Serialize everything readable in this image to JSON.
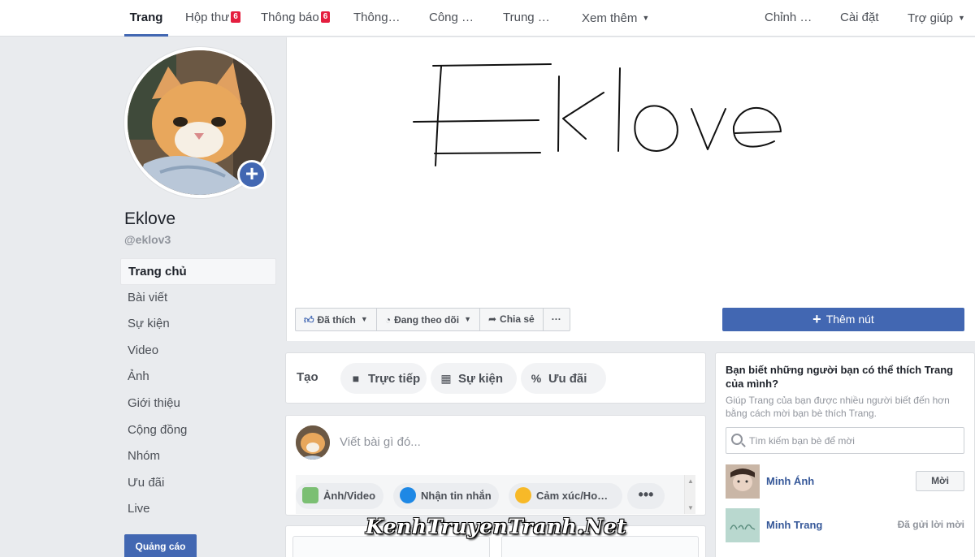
{
  "nav": {
    "tabs": [
      {
        "label": "Trang"
      },
      {
        "label": "Hộp thư",
        "badge": "6"
      },
      {
        "label": "Thông báo",
        "badge": "6"
      },
      {
        "label": "Thông…"
      },
      {
        "label": "Công …"
      },
      {
        "label": "Trung …"
      },
      {
        "label": "Xem thêm"
      }
    ],
    "right": [
      {
        "label": "Chỉnh …"
      },
      {
        "label": "Cài đặt"
      },
      {
        "label": "Trợ giúp"
      }
    ]
  },
  "page": {
    "name": "Eklove",
    "handle": "@eklov3",
    "cover_text": "Eklove"
  },
  "sidebar": {
    "items": [
      {
        "label": "Trang chủ"
      },
      {
        "label": "Bài viết"
      },
      {
        "label": "Sự kiện"
      },
      {
        "label": "Video"
      },
      {
        "label": "Ảnh"
      },
      {
        "label": "Giới thiệu"
      },
      {
        "label": "Cộng đồng"
      },
      {
        "label": "Nhóm"
      },
      {
        "label": "Ưu đãi"
      },
      {
        "label": "Live"
      }
    ],
    "ads_button": "Quảng cáo"
  },
  "actions": {
    "liked": "Đã thích",
    "following": "Đang theo dõi",
    "share": "Chia sẻ",
    "more": "···",
    "add_button": "Thêm nút"
  },
  "create": {
    "label": "Tạo",
    "live": "Trực tiếp",
    "event": "Sự kiện",
    "offer": "Ưu đãi"
  },
  "composer": {
    "placeholder": "Viết bài gì đó...",
    "photo": "Ảnh/Video",
    "messages": "Nhận tin nhắn",
    "feeling": "Cảm xúc/Ho…",
    "more": "•••"
  },
  "invite": {
    "title": "Bạn biết những người bạn có thể thích Trang của mình?",
    "desc": "Giúp Trang của bạn được nhiều người biết đến hơn bằng cách mời bạn bè thích Trang.",
    "search_placeholder": "Tìm kiếm bạn bè để mời",
    "friends": [
      {
        "name": "Minh Ánh",
        "action": "Mời"
      },
      {
        "name": "Minh Trang",
        "action": "Đã gửi lời mời"
      }
    ]
  },
  "watermark": "KenhTruyenTranh.Net",
  "colors": {
    "brand": "#4267b2",
    "badge": "#e41e3f",
    "background": "#e9ebee",
    "link": "#365899"
  }
}
